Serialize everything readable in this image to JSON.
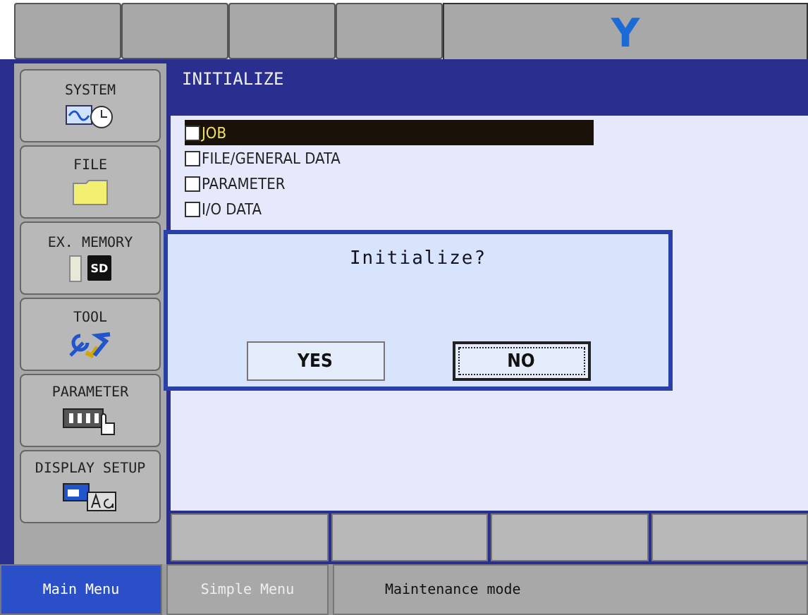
{
  "top_bar": {
    "display": "Y"
  },
  "main_menu": [
    {
      "label": "SYSTEM",
      "kind": "system"
    },
    {
      "label": "FILE",
      "kind": "file"
    },
    {
      "label": "EX. MEMORY",
      "kind": "memory",
      "card_label": "SD"
    },
    {
      "label": "TOOL",
      "kind": "tool"
    },
    {
      "label": "PARAMETER",
      "kind": "parameter"
    },
    {
      "label": "DISPLAY SETUP",
      "kind": "display"
    }
  ],
  "panel": {
    "title": "INITIALIZE",
    "items": [
      {
        "label": "JOB",
        "checked": false,
        "selected": true
      },
      {
        "label": "FILE/GENERAL DATA",
        "checked": false,
        "selected": false
      },
      {
        "label": "PARAMETER",
        "checked": false,
        "selected": false
      },
      {
        "label": "I/O DATA",
        "checked": false,
        "selected": false
      }
    ]
  },
  "dialog": {
    "message": "Initialize?",
    "buttons": [
      {
        "label": "YES",
        "selected": false
      },
      {
        "label": "NO",
        "selected": true
      }
    ]
  },
  "status_bar": [
    {
      "label": "Main Menu",
      "selected": true
    },
    {
      "label": "Simple Menu",
      "selected": false
    },
    {
      "label": "Maintenance mode",
      "selected": false
    }
  ]
}
